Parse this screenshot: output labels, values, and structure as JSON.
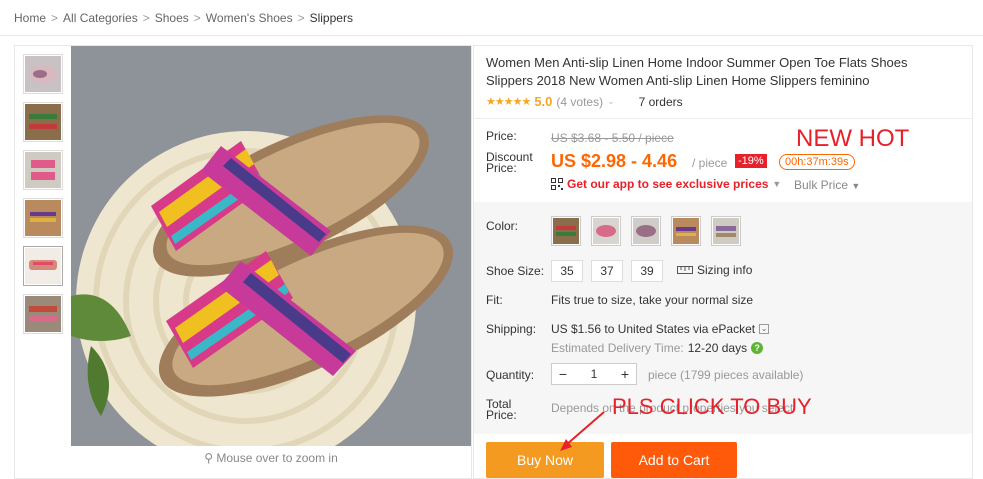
{
  "breadcrumb": {
    "items": [
      "Home",
      "All Categories",
      "Shoes",
      "Women's Shoes"
    ],
    "current": "Slippers",
    "separator": ">"
  },
  "gallery": {
    "zoom_hint": "Mouse over to zoom in",
    "thumbnail_count": 6
  },
  "product": {
    "title": "Women Men Anti-slip Linen Home Indoor Summer Open Toe Flats Shoes Slippers 2018 New Women Anti-slip Linen Home Slippers feminino",
    "stars": "★★★★★",
    "rating": "5.0",
    "votes": "(4 votes)",
    "orders": "7 orders"
  },
  "price": {
    "price_label": "Price:",
    "old_price": "US $3.68 - 5.50 / piece",
    "discount_label_1": "Discount",
    "discount_label_2": "Price:",
    "discount_price": "US $2.98 - 4.46",
    "per_piece": "/ piece",
    "discount_badge": "-19%",
    "timer": "00h:37m:39s",
    "app_text": "Get our app to see exclusive prices",
    "bulk": "Bulk Price",
    "overlay_text": "NEW HOT"
  },
  "options": {
    "color_label": "Color:",
    "size_label": "Shoe Size:",
    "sizes": [
      "35",
      "37",
      "39"
    ],
    "sizing_info": "Sizing info",
    "fit_label": "Fit:",
    "fit_text": "Fits true to size, take your normal size",
    "shipping_label": "Shipping:",
    "shipping_text": "US $1.56 to United States via ePacket",
    "delivery_label": "Estimated Delivery Time:",
    "delivery_days": "12-20 days",
    "quantity_label": "Quantity:",
    "quantity_value": "1",
    "minus": "−",
    "plus": "+",
    "availability": "piece (1799 pieces available)",
    "total_label_1": "Total",
    "total_label_2": "Price:",
    "total_note": "Depends on the product properties you select",
    "overlay_text": "PLS CLICK TO BUY"
  },
  "actions": {
    "buy_now": "Buy Now",
    "add_to_cart": "Add to Cart"
  },
  "colors": {
    "accent_orange": "#f60",
    "red": "#e8202a",
    "buy_now_bg": "#f49a20",
    "add_to_cart_bg": "#fe5a0a",
    "star": "#f5a623"
  }
}
